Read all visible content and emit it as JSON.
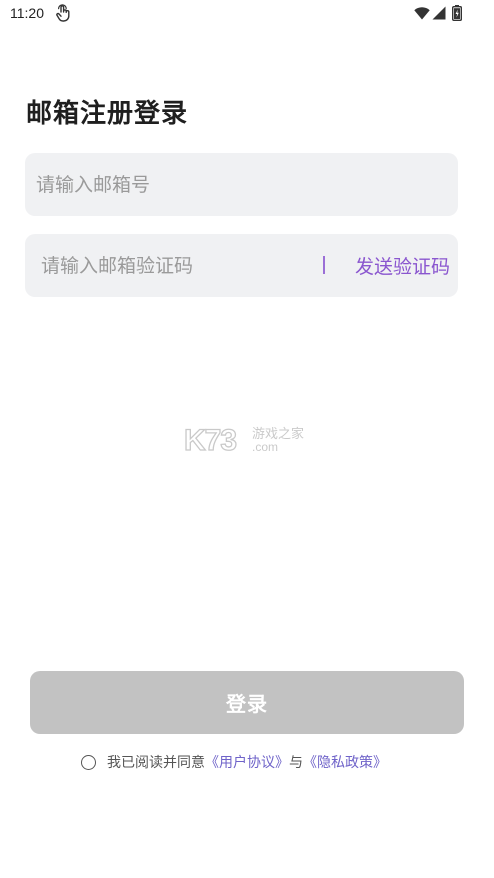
{
  "status_bar": {
    "time": "11:20",
    "icons": [
      "touch-icon",
      "wifi-icon",
      "signal-icon",
      "battery-icon"
    ]
  },
  "page_title": "邮箱注册登录",
  "email_field": {
    "value": "",
    "placeholder": "请输入邮箱号"
  },
  "code_field": {
    "value": "",
    "placeholder": "请输入邮箱验证码",
    "divider": "|",
    "send_code_label": "发送验证码"
  },
  "watermark": {
    "logo_text": "K73",
    "site_text": "游戏之家",
    "domain_text": ".com"
  },
  "login_button": {
    "label": "登录",
    "state": "disabled"
  },
  "agreement": {
    "checked": false,
    "prefix": "我已阅读并同意",
    "user_agreement_link": "《用户协议》",
    "connector": "与",
    "privacy_policy_link": "《隐私政策》"
  },
  "colors": {
    "accent": "#8a56cf",
    "link": "#6f63c9",
    "input_bg": "#f0f1f3",
    "button_disabled_bg": "#c2c2c2",
    "title": "#1f1f1f"
  }
}
